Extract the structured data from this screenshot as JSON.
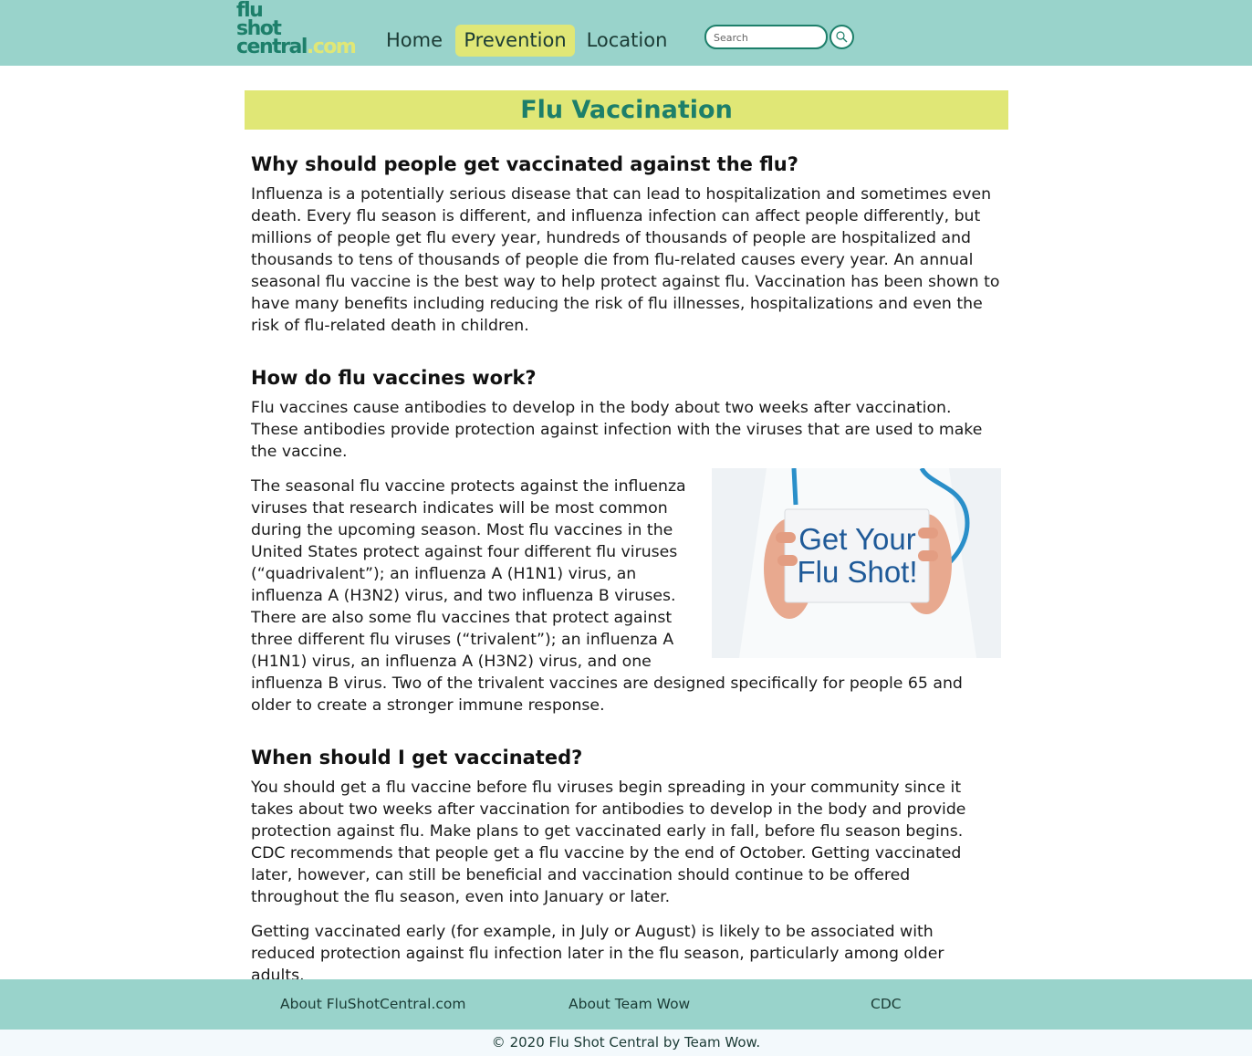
{
  "header": {
    "logo": {
      "line1": "flu",
      "line2": "shot",
      "line3": "central",
      "suffix": ".com"
    },
    "nav": [
      {
        "label": "Home"
      },
      {
        "label": "Prevention",
        "active": true
      },
      {
        "label": "Location"
      }
    ],
    "search": {
      "placeholder": "Search",
      "icon": "search-icon"
    }
  },
  "page": {
    "title": "Flu Vaccination",
    "sections": [
      {
        "heading": "Why should people get vaccinated against the flu?",
        "paragraphs": [
          "Influenza is a potentially serious disease that can lead to hospitalization and sometimes even death. Every flu season is different, and influenza infection can affect people differently, but millions of people get flu every year, hundreds of thousands of people are hospitalized and thousands to tens of thousands of people die from flu-related causes every year. An annual seasonal flu vaccine is the best way to help protect against flu. Vaccination has been shown to have many benefits including reducing the risk of flu illnesses, hospitalizations and even the risk of flu-related death in children."
        ]
      },
      {
        "heading": "How do flu vaccines work?",
        "paragraphs": [
          "Flu vaccines cause antibodies to develop in the body about two weeks after vaccination. These antibodies provide protection against infection with the viruses that are used to make the vaccine.",
          "The seasonal flu vaccine protects against the influenza viruses that research indicates will be most common during the upcoming season. Most flu vaccines in the United States protect against four different flu viruses (“quadrivalent”); an influenza A (H1N1) virus, an influenza A (H3N2) virus, and two influenza B viruses. There are also some flu vaccines that protect against three different flu viruses (“trivalent”); an influenza A (H1N1) virus, an influenza A (H3N2) virus, and one influenza B virus. Two of the trivalent vaccines are designed specifically for people 65 and older to create a stronger immune response."
        ],
        "image_text": "Get Your Flu Shot!"
      },
      {
        "heading": "When should I get vaccinated?",
        "paragraphs": [
          "You should get a flu vaccine before flu viruses begin spreading in your community since it takes about two weeks after vaccination for antibodies to develop in the body and provide protection against flu. Make plans to get vaccinated early in fall, before flu season begins. CDC recommends that people get a flu vaccine by the end of October. Getting vaccinated later, however, can still be beneficial and vaccination should continue to be offered throughout the flu season, even into January or later.",
          "Getting vaccinated early (for example, in July or August) is likely to be associated with reduced protection against flu infection later in the flu season, particularly among older adults."
        ]
      }
    ]
  },
  "footer": {
    "links": [
      {
        "label": "About FluShotCentral.com"
      },
      {
        "label": "About Team Wow"
      },
      {
        "label": "CDC"
      }
    ],
    "copyright": "© 2020 Flu Shot Central by Team Wow."
  },
  "colors": {
    "header_bg": "#99d3cb",
    "accent_yellow": "#e0e776",
    "brand_green": "#1d7f6a",
    "footer_bottom_bg": "#f3f9fc"
  }
}
